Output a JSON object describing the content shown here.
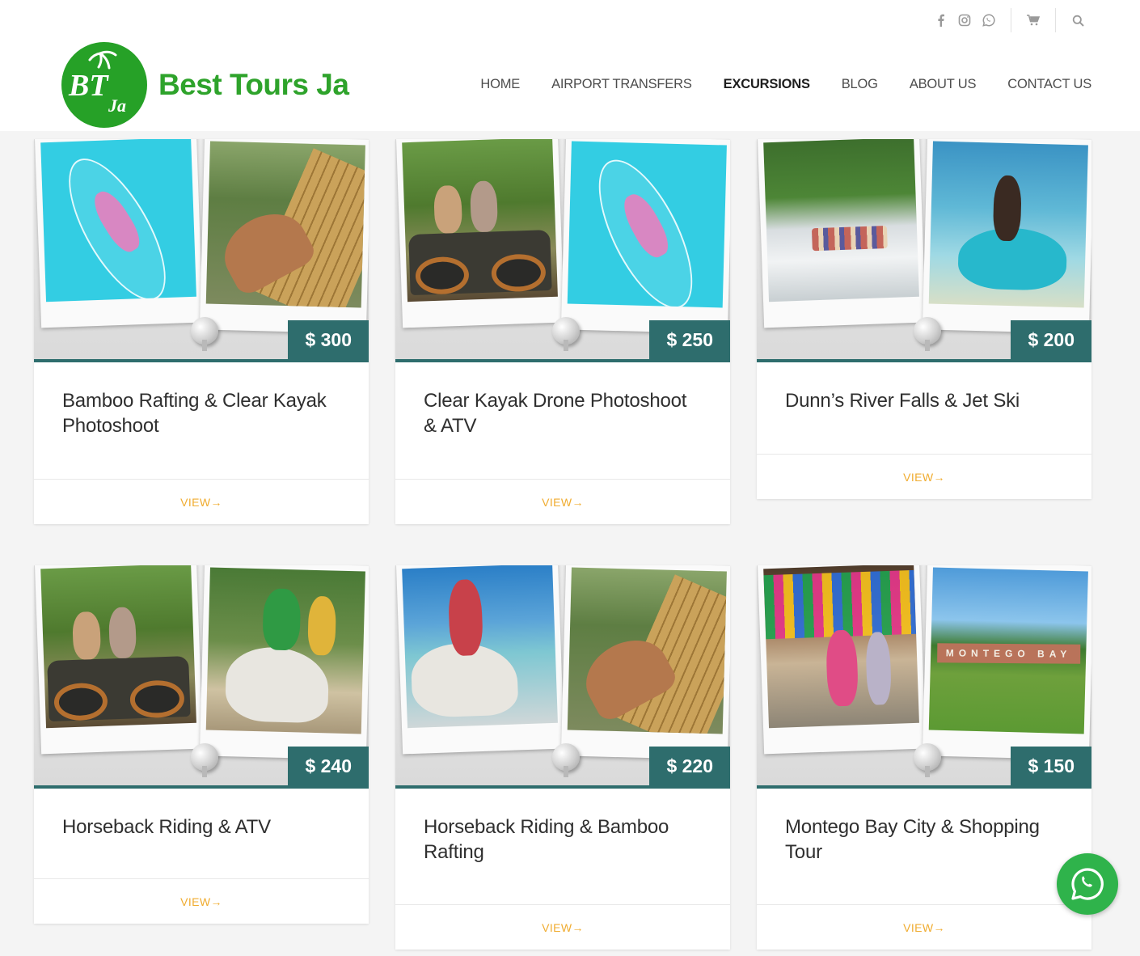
{
  "brand": {
    "name": "Best Tours Ja",
    "logo_mark": "BTJa",
    "color": "#2ea32b"
  },
  "topbar": {
    "icons": [
      "facebook-icon",
      "instagram-icon",
      "whatsapp-icon",
      "cart-icon",
      "search-icon"
    ]
  },
  "nav": {
    "items": [
      {
        "label": "HOME",
        "active": false
      },
      {
        "label": "AIRPORT TRANSFERS",
        "active": false
      },
      {
        "label": "EXCURSIONS",
        "active": true
      },
      {
        "label": "BLOG",
        "active": false
      },
      {
        "label": "ABOUT US",
        "active": false
      },
      {
        "label": "CONTACT US",
        "active": false
      }
    ]
  },
  "tours": [
    {
      "title": "Bamboo Rafting & Clear Kayak Photoshoot",
      "price": "$ 300",
      "view": "VIEW→",
      "photos": [
        "clear kayak",
        "bamboo raft"
      ]
    },
    {
      "title": "Clear Kayak Drone Photoshoot & ATV",
      "price": "$ 250",
      "view": "VIEW→",
      "photos": [
        "atv",
        "clear kayak"
      ]
    },
    {
      "title": "Dunn’s River Falls & Jet Ski",
      "price": "$ 200",
      "view": "VIEW→",
      "photos": [
        "waterfall",
        "jet ski"
      ]
    },
    {
      "title": "Horseback Riding & ATV",
      "price": "$ 240",
      "view": "VIEW→",
      "photos": [
        "atv",
        "horse"
      ]
    },
    {
      "title": "Horseback Riding & Bamboo Rafting",
      "price": "$ 220",
      "view": "VIEW→",
      "photos": [
        "horse on beach",
        "bamboo raft"
      ]
    },
    {
      "title": "Montego Bay City & Shopping Tour",
      "price": "$ 150",
      "view": "VIEW→",
      "photos": [
        "market",
        "montego bay sign"
      ]
    }
  ],
  "bay_sign_text": "MONTEGO BAY",
  "colors": {
    "price_badge": "#2e6d6d",
    "view_link": "#f0ac30",
    "whatsapp": "#2fb34b"
  }
}
